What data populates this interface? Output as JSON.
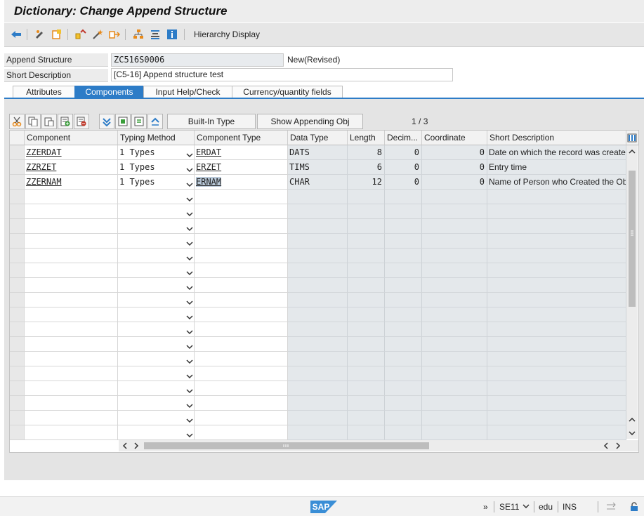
{
  "window": {
    "title": "Dictionary: Change Append Structure"
  },
  "toolbar": {
    "hierarchy_label": "Hierarchy Display"
  },
  "header": {
    "append_structure_label": "Append Structure",
    "append_structure_value": "ZC516S0006",
    "status": "New(Revised)",
    "short_desc_label": "Short Description",
    "short_desc_value": "[C5-16] Append structure test"
  },
  "tabs": [
    "Attributes",
    "Components",
    "Input Help/Check",
    "Currency/quantity fields"
  ],
  "table_toolbar": {
    "builtin_label": "Built-In Type",
    "show_appending_label": "Show Appending Obj",
    "page_current": "1",
    "page_sep": "/",
    "page_total": "3"
  },
  "columns": [
    "Component",
    "Typing Method",
    "Component Type",
    "Data Type",
    "Length",
    "Decim...",
    "Coordinate",
    "Short Description"
  ],
  "rows": [
    {
      "component": "ZZERDAT",
      "typing": "1 Types",
      "comp_type": "ERDAT",
      "data_type": "DATS",
      "length": "8",
      "decimals": "0",
      "coordinate": "0",
      "desc": "Date on which the record was created"
    },
    {
      "component": "ZZRZET",
      "typing": "1 Types",
      "comp_type": "ERZET",
      "data_type": "TIMS",
      "length": "6",
      "decimals": "0",
      "coordinate": "0",
      "desc": "Entry time"
    },
    {
      "component": "ZZERNAM",
      "typing": "1 Types",
      "comp_type": "ERNAM",
      "data_type": "CHAR",
      "length": "12",
      "decimals": "0",
      "coordinate": "0",
      "desc": "Name of Person who Created the Object"
    }
  ],
  "statusbar": {
    "brand": "SAP",
    "tcode": "SE11",
    "client": "edu",
    "mode": "INS"
  }
}
